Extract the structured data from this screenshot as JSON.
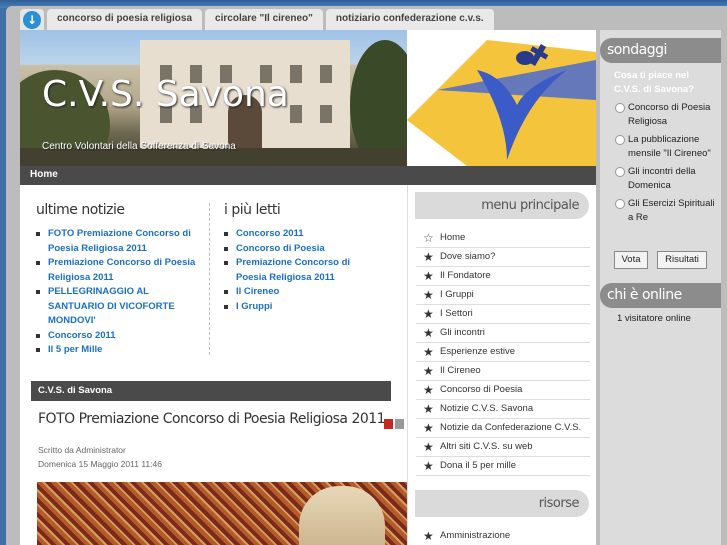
{
  "topnav": {
    "tabs": [
      {
        "label": "concorso di poesia religiosa"
      },
      {
        "label": "circolare \"Il cireneo\""
      },
      {
        "label": "notiziario confederazione c.v.s."
      }
    ]
  },
  "header": {
    "title": "C.V.S. Savona",
    "subtitle": "Centro Volontari della Sofferenza di Savona"
  },
  "breadcrumb": {
    "home": "Home"
  },
  "news": {
    "heading": "ultime notizie",
    "items": [
      {
        "label": "FOTO Premiazione Concorso di Poesia Religiosa 2011"
      },
      {
        "label": "Premiazione Concorso di Poesia Religiosa 2011"
      },
      {
        "label": "PELLEGRINAGGIO AL SANTUARIO DI VICOFORTE MONDOVI'"
      },
      {
        "label": "Concorso 2011"
      },
      {
        "label": "Il 5 per Mille"
      }
    ]
  },
  "popular": {
    "heading": "i più letti",
    "items": [
      {
        "label": "Concorso 2011"
      },
      {
        "label": "Concorso di Poesia"
      },
      {
        "label": "Premiazione Concorso di Poesia Religiosa 2011"
      },
      {
        "label": "Il Cireneo"
      },
      {
        "label": "I Gruppi"
      }
    ]
  },
  "section": {
    "label": "C.V.S. di Savona"
  },
  "article": {
    "title": "FOTO Premiazione Concorso di Poesia Religiosa 2011",
    "author": "Scritto da Administrator",
    "date": "Domenica 15 Maggio 2011 11:46"
  },
  "main_menu": {
    "heading": "menu principale",
    "items": [
      {
        "label": "Home",
        "icon": "star-outline-icon"
      },
      {
        "label": "Dove siamo?",
        "icon": "star-icon"
      },
      {
        "label": "Il Fondatore",
        "icon": "star-icon"
      },
      {
        "label": "I Gruppi",
        "icon": "star-icon"
      },
      {
        "label": "I Settori",
        "icon": "star-icon"
      },
      {
        "label": "Gli incontri",
        "icon": "star-icon"
      },
      {
        "label": "Esperienze estive",
        "icon": "star-icon"
      },
      {
        "label": "Il Cireneo",
        "icon": "star-icon"
      },
      {
        "label": "Concorso di Poesia",
        "icon": "star-icon"
      },
      {
        "label": "Notizie C.V.S. Savona",
        "icon": "star-icon"
      },
      {
        "label": "Notizie da Confederazione C.V.S.",
        "icon": "star-icon"
      },
      {
        "label": "Altri siti C.V.S. su web",
        "icon": "star-icon"
      },
      {
        "label": "Dona il 5 per mille",
        "icon": "star-icon"
      }
    ]
  },
  "resources": {
    "heading": "risorse",
    "items": [
      {
        "label": "Amministrazione",
        "icon": "star-icon"
      }
    ]
  },
  "poll": {
    "heading": "sondaggi",
    "question": "Cosa ti piace nel C.V.S. di Savona?",
    "options": [
      {
        "label": "Concorso di Poesia Religiosa"
      },
      {
        "label": "La pubblicazione mensile \"Il Cireneo\""
      },
      {
        "label": "Gli incontri della Domenica"
      },
      {
        "label": "Gli Esercizi Spirituali a Re"
      }
    ],
    "vote_label": "Vota",
    "results_label": "Risultati"
  },
  "whos_online": {
    "heading": "chi è online",
    "text": "1 visitatore online"
  },
  "colors": {
    "link": "#1a6fc7",
    "bar": "#4a4a4a",
    "accent": "#2b8fd8"
  }
}
